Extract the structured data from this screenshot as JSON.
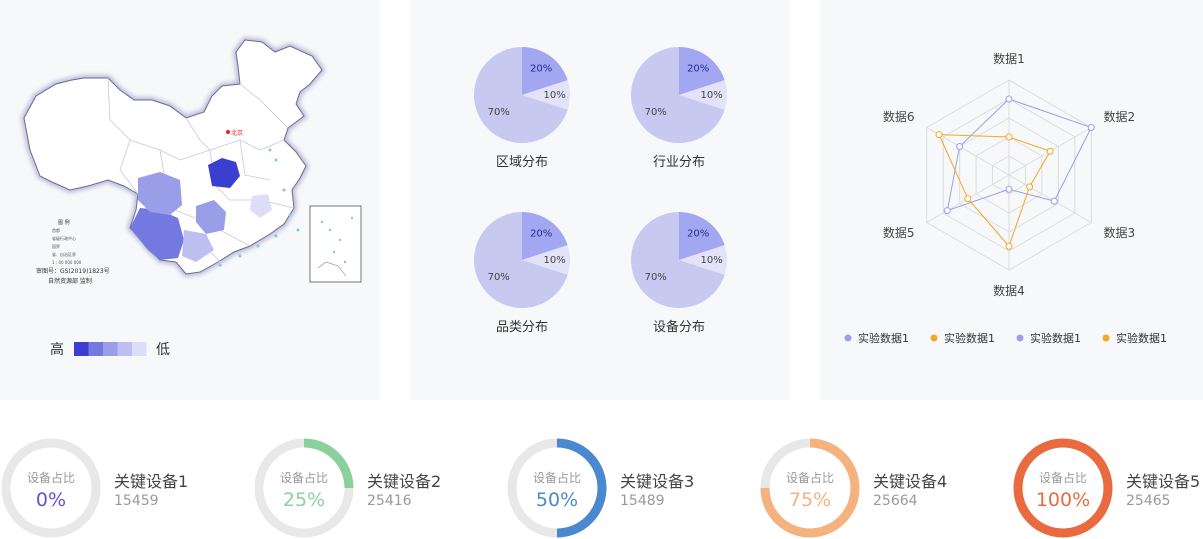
{
  "map": {
    "legend_high": "高",
    "legend_low": "低",
    "legend_colors": [
      "#3a3fd0",
      "#7479e0",
      "#9a9ee8",
      "#bcbff0",
      "#dcdef7"
    ],
    "capital_label": "北京",
    "legend_block_title": "图 例",
    "legend_block_rows": [
      "首都",
      "省级行政中心",
      "国界",
      "省、自治区界",
      "1 : 40 000 000"
    ],
    "approval_no": "审图号：GS(2019)1823号",
    "publisher": "自然资源部 监制"
  },
  "pies": [
    {
      "title": "区域分布",
      "slices": [
        {
          "label": "20%",
          "value": 20
        },
        {
          "label": "10%",
          "value": 10
        },
        {
          "label": "70%",
          "value": 70
        }
      ]
    },
    {
      "title": "行业分布",
      "slices": [
        {
          "label": "20%",
          "value": 20
        },
        {
          "label": "10%",
          "value": 10
        },
        {
          "label": "70%",
          "value": 70
        }
      ]
    },
    {
      "title": "品类分布",
      "slices": [
        {
          "label": "20%",
          "value": 20
        },
        {
          "label": "10%",
          "value": 10
        },
        {
          "label": "70%",
          "value": 70
        }
      ]
    },
    {
      "title": "设备分布",
      "slices": [
        {
          "label": "20%",
          "value": 20
        },
        {
          "label": "10%",
          "value": 10
        },
        {
          "label": "70%",
          "value": 70
        }
      ]
    }
  ],
  "pie_colors": [
    "#a3a6f0",
    "#e2e3f8",
    "#c7c9f1"
  ],
  "chart_data": {
    "type": "radar",
    "indicators": [
      "数据1",
      "数据2",
      "数据3",
      "数据4",
      "数据5",
      "数据6"
    ],
    "max": 100,
    "series": [
      {
        "name": "实验数据1",
        "color": "#9c9ff0",
        "values": [
          80,
          100,
          55,
          15,
          75,
          60
        ]
      },
      {
        "name": "实验数据1",
        "color": "#f5a623",
        "values": [
          40,
          50,
          25,
          75,
          50,
          85
        ]
      }
    ],
    "legend": [
      {
        "name": "实验数据1",
        "color": "#9c9ff0"
      },
      {
        "name": "实验数据1",
        "color": "#f5a623"
      },
      {
        "name": "实验数据1",
        "color": "#9c9ff0"
      },
      {
        "name": "实验数据1",
        "color": "#f5a623"
      }
    ],
    "legend_position": "bottom"
  },
  "gauges": [
    {
      "inner_label": "设备占比",
      "value_label": "0%",
      "percent": 0,
      "name": "关键设备1",
      "number": "15459",
      "color": "#6a4fd6"
    },
    {
      "inner_label": "设备占比",
      "value_label": "25%",
      "percent": 25,
      "name": "关键设备2",
      "number": "25416",
      "color": "#8bd19d"
    },
    {
      "inner_label": "设备占比",
      "value_label": "50%",
      "percent": 50,
      "name": "关键设备3",
      "number": "15489",
      "color": "#4a89d0"
    },
    {
      "inner_label": "设备占比",
      "value_label": "75%",
      "percent": 75,
      "name": "关键设备4",
      "number": "25664",
      "color": "#f4b27e"
    },
    {
      "inner_label": "设备占比",
      "value_label": "100%",
      "percent": 100,
      "name": "关键设备5",
      "number": "25465",
      "color": "#ea6a3f"
    }
  ],
  "gauge_track_color": "#e8e8e8"
}
